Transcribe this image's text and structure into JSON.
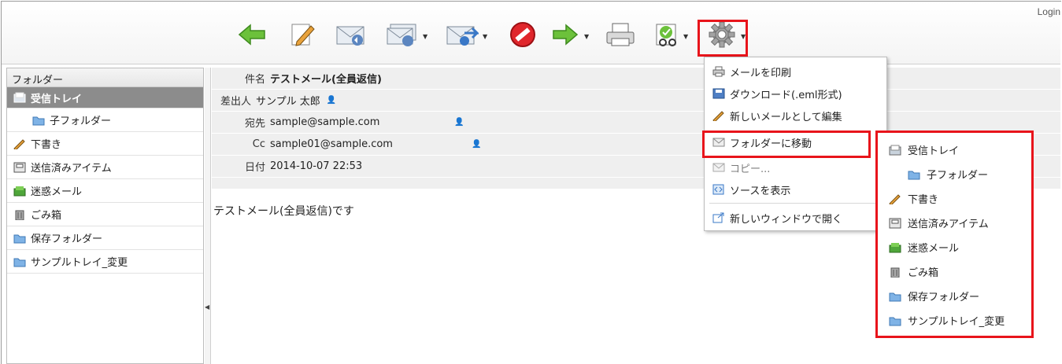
{
  "header": {
    "login_text": "Login"
  },
  "toolbar": {
    "icons": [
      "back-arrow-icon",
      "compose-pencil-icon",
      "reply-mail-icon",
      "reply-all-mail-icon",
      "forward-mail-icon",
      "stop-icon",
      "move-arrow-icon",
      "print-icon",
      "mark-icon",
      "gear-icon"
    ]
  },
  "folders": {
    "header": "フォルダー",
    "items": [
      {
        "label": "受信トレイ",
        "icon": "inbox-icon",
        "selected": true
      },
      {
        "label": "子フォルダー",
        "icon": "folder-icon"
      },
      {
        "label": "下書き",
        "icon": "pencil-icon"
      },
      {
        "label": "送信済みアイテム",
        "icon": "sent-icon"
      },
      {
        "label": "迷惑メール",
        "icon": "junk-icon"
      },
      {
        "label": "ごみ箱",
        "icon": "trash-icon"
      },
      {
        "label": "保存フォルダー",
        "icon": "folder-icon"
      },
      {
        "label": "サンプルトレイ_変更",
        "icon": "folder-icon"
      }
    ]
  },
  "message": {
    "subject_label": "件名",
    "subject": "テストメール(全員返信)",
    "from_label": "差出人",
    "from": "サンプル 太郎",
    "to_label": "宛先",
    "to": "sample@sample.com",
    "cc_label": "Cc",
    "cc": "sample01@sample.com",
    "date_label": "日付",
    "date": "2014-10-07 22:53",
    "body": "テストメール(全員返信)です"
  },
  "menu": {
    "items": [
      {
        "label": "メールを印刷",
        "icon": "print-icon"
      },
      {
        "label": "ダウンロード(.eml形式)",
        "icon": "save-icon"
      },
      {
        "label": "新しいメールとして編集",
        "icon": "pencil-icon"
      },
      {
        "label": "フォルダーに移動",
        "icon": "move-mail-icon"
      },
      {
        "label": "コピー...",
        "icon": "copy-mail-icon"
      },
      {
        "label": "ソースを表示",
        "icon": "source-icon"
      },
      {
        "label": "新しいウィンドウで開く",
        "icon": "new-window-icon"
      }
    ]
  },
  "submenu": {
    "items": [
      {
        "label": "受信トレイ",
        "icon": "inbox-icon"
      },
      {
        "label": "子フォルダー",
        "icon": "folder-icon"
      },
      {
        "label": "下書き",
        "icon": "pencil-icon"
      },
      {
        "label": "送信済みアイテム",
        "icon": "sent-icon"
      },
      {
        "label": "迷惑メール",
        "icon": "junk-icon"
      },
      {
        "label": "ごみ箱",
        "icon": "trash-icon"
      },
      {
        "label": "保存フォルダー",
        "icon": "folder-icon"
      },
      {
        "label": "サンプルトレイ_変更",
        "icon": "folder-icon"
      }
    ]
  },
  "colors": {
    "highlight": "#e8141b",
    "selected_bg": "#8c8c8c",
    "header_bg": "#efefef"
  }
}
